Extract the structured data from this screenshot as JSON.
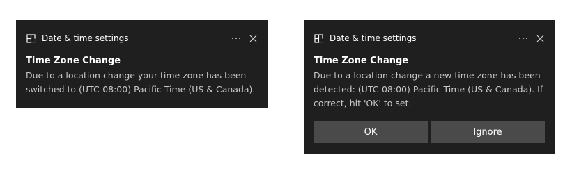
{
  "toasts": [
    {
      "app_icon": "settings-panel-icon",
      "app_name": "Date & time settings",
      "more_icon": "more-dots-icon",
      "close_icon": "close-icon",
      "title": "Time Zone Change",
      "body": "Due to a location change your time zone has been switched to (UTC-08:00) Pacific Time (US & Canada)."
    },
    {
      "app_icon": "settings-panel-icon",
      "app_name": "Date & time settings",
      "more_icon": "more-dots-icon",
      "close_icon": "close-icon",
      "title": "Time Zone Change",
      "body": "Due to a location change a new time zone has been detected: (UTC-08:00) Pacific Time (US & Canada). If correct, hit 'OK' to set.",
      "actions": {
        "ok_label": "OK",
        "ignore_label": "Ignore"
      }
    }
  ],
  "colors": {
    "toast_background": "#1f1f1f",
    "button_background": "#4a4a4a",
    "body_text": "#c8c8c8",
    "primary_text": "#ffffff"
  }
}
